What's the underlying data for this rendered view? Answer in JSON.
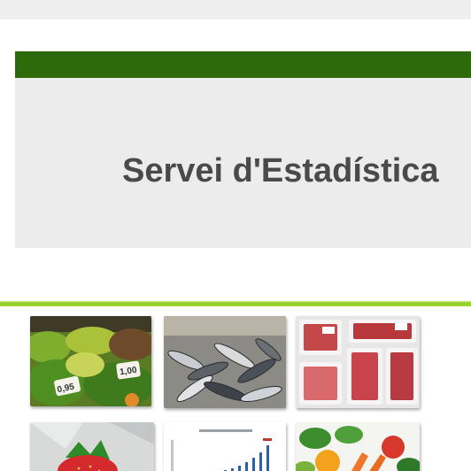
{
  "header": {
    "title": "Servei d'Estadística"
  },
  "colors": {
    "brand_green": "#2d6a0b",
    "accent_lime": "#8fce1f",
    "panel_gray": "#ececec",
    "title_gray": "#4a4a4a"
  },
  "gallery": {
    "tiles": [
      {
        "name": "vegetable-market-photo",
        "price_tags": [
          "0,95",
          "1,00"
        ]
      },
      {
        "name": "fish-photo"
      },
      {
        "name": "meat-trays-photo"
      },
      {
        "name": "strawberries-photo"
      },
      {
        "name": "statistics-chart-thumbnail"
      },
      {
        "name": "fresh-vegetables-photo"
      }
    ]
  }
}
